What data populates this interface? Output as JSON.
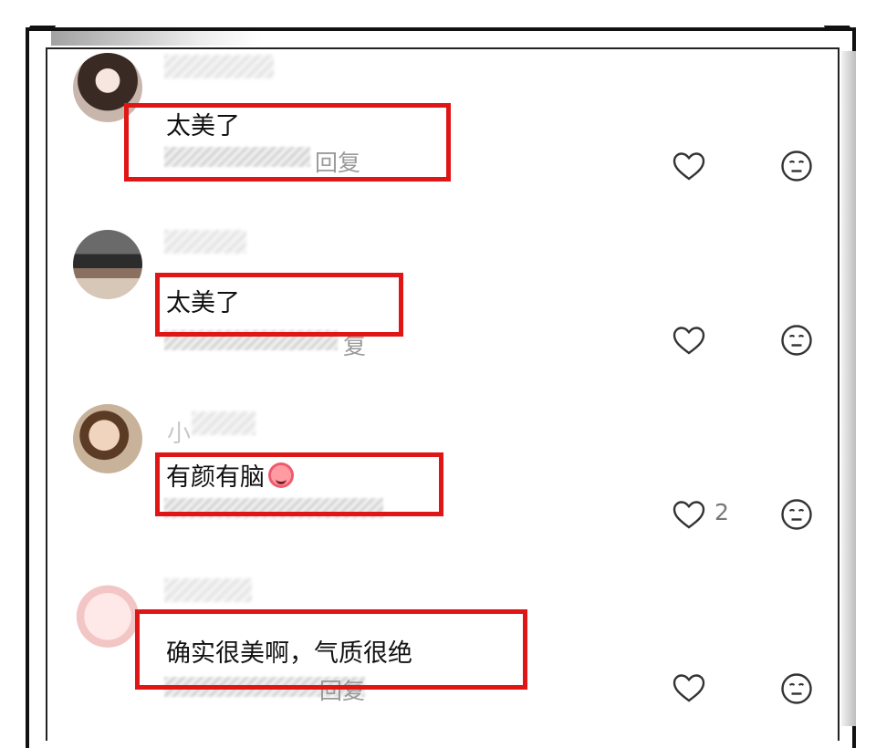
{
  "comments": [
    {
      "text": "太美了",
      "reply": "回复",
      "likes": ""
    },
    {
      "text": "太美了",
      "reply": "复",
      "likes": ""
    },
    {
      "name": "小",
      "text": "有颜有脑",
      "reply": "",
      "likes": "2"
    },
    {
      "text": "确实很美啊，气质很绝",
      "reply": "回复",
      "likes": ""
    }
  ],
  "icons": {
    "like": "heart-outline-icon",
    "react": "neutral-face-icon",
    "emoji": "crying-emoji-icon"
  },
  "colors": {
    "highlight": "#e01616",
    "text": "#111111",
    "muted": "#9a9a9a"
  }
}
